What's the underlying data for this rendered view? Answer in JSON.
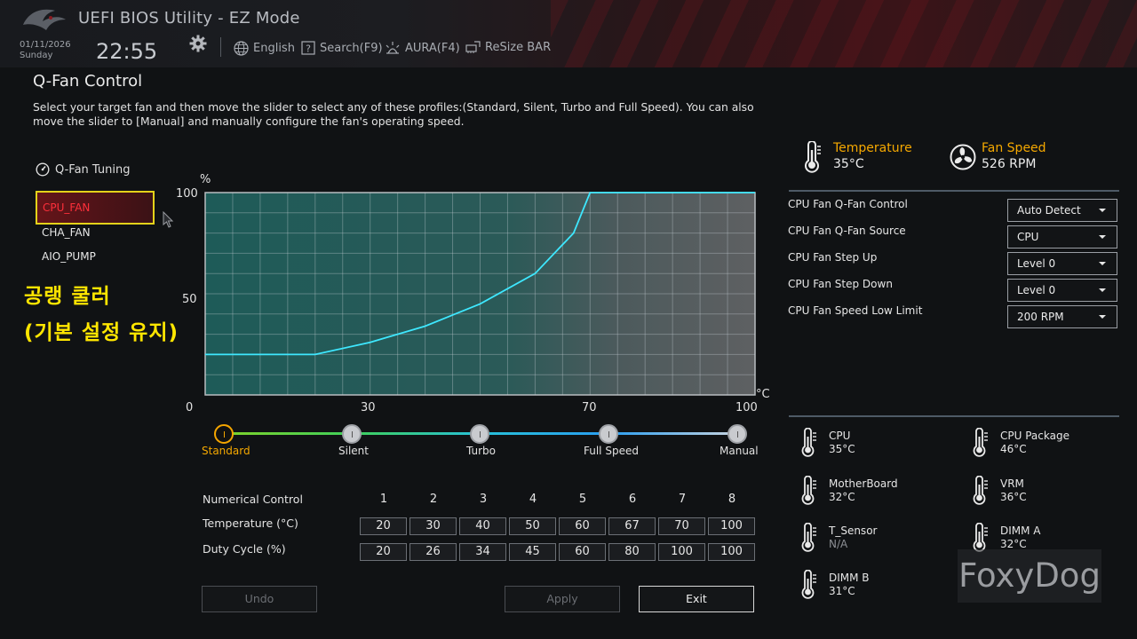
{
  "header": {
    "title": "UEFI BIOS Utility - EZ Mode",
    "date": "01/11/2026",
    "day": "Sunday",
    "time": "22:55",
    "language": "English",
    "search": "Search(F9)",
    "aura": "AURA(F4)",
    "resize_bar": "ReSize BAR"
  },
  "page": {
    "title": "Q-Fan Control",
    "description": "Select your target fan and then move the slider to select any of these profiles:(Standard, Silent, Turbo and Full Speed). You can also move the slider to [Manual] and manually configure the fan's operating speed."
  },
  "fans": {
    "tuning_label": "Q-Fan Tuning",
    "items": [
      "CPU_FAN",
      "CHA_FAN",
      "AIO_PUMP"
    ],
    "selected": "CPU_FAN"
  },
  "annotation": {
    "line1": "공랭 쿨러",
    "line2": "(기본 설정 유지)"
  },
  "chart_data": {
    "type": "line",
    "ylabel": "%",
    "xlabel": "°C",
    "xlim": [
      0,
      100
    ],
    "ylim": [
      0,
      100
    ],
    "x_ticks": [
      "0",
      "30",
      "70",
      "100"
    ],
    "y_ticks": [
      "100",
      "50"
    ],
    "x": [
      0,
      20,
      30,
      40,
      50,
      60,
      67,
      70,
      100
    ],
    "y": [
      20,
      20,
      26,
      34,
      45,
      60,
      80,
      100,
      100
    ],
    "series_color": "#3ee8ff",
    "grid": true
  },
  "profiles": {
    "items": [
      "Standard",
      "Silent",
      "Turbo",
      "Full Speed",
      "Manual"
    ],
    "selected": "Standard"
  },
  "numerical": {
    "label": "Numerical Control",
    "columns": [
      "1",
      "2",
      "3",
      "4",
      "5",
      "6",
      "7",
      "8"
    ],
    "temperature_label": "Temperature (°C)",
    "temperatures": [
      "20",
      "30",
      "40",
      "50",
      "60",
      "67",
      "70",
      "100"
    ],
    "duty_label": "Duty Cycle (%)",
    "duties": [
      "20",
      "26",
      "34",
      "45",
      "60",
      "80",
      "100",
      "100"
    ]
  },
  "buttons": {
    "undo": "Undo",
    "apply": "Apply",
    "exit": "Exit"
  },
  "status": {
    "temperature_title": "Temperature",
    "temperature_value": "35°C",
    "fan_speed_title": "Fan Speed",
    "fan_speed_value": "526 RPM"
  },
  "settings": [
    {
      "label": "CPU Fan Q-Fan Control",
      "value": "Auto Detect"
    },
    {
      "label": "CPU Fan Q-Fan Source",
      "value": "CPU"
    },
    {
      "label": "CPU Fan Step Up",
      "value": "Level 0"
    },
    {
      "label": "CPU Fan Step Down",
      "value": "Level 0"
    },
    {
      "label": "CPU Fan Speed Low Limit",
      "value": "200 RPM"
    }
  ],
  "sensors": [
    {
      "name": "CPU",
      "value": "35°C"
    },
    {
      "name": "CPU Package",
      "value": "46°C"
    },
    {
      "name": "MotherBoard",
      "value": "32°C"
    },
    {
      "name": "VRM",
      "value": "36°C"
    },
    {
      "name": "T_Sensor",
      "value": "N/A"
    },
    {
      "name": "DIMM A",
      "value": "32°C"
    },
    {
      "name": "DIMM B",
      "value": "31°C"
    }
  ],
  "watermark": "FoxyDog"
}
